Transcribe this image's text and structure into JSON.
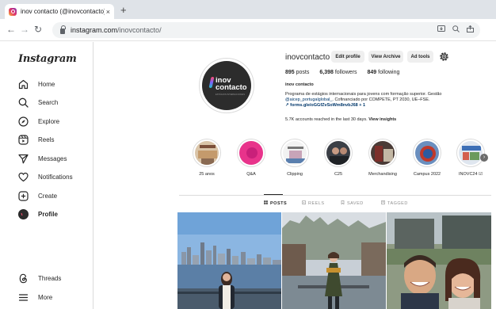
{
  "browser": {
    "tab_title": "inov contacto (@inovcontacto) •",
    "tab_close": "×",
    "new_tab": "+",
    "back": "←",
    "forward": "→",
    "reload": "↻",
    "url_host": "instagram.com",
    "url_path": "/inovcontacto/"
  },
  "sidebar": {
    "logo": "Instagram",
    "items": [
      {
        "label": "Home",
        "icon": "home-icon"
      },
      {
        "label": "Search",
        "icon": "search-icon"
      },
      {
        "label": "Explore",
        "icon": "compass-icon"
      },
      {
        "label": "Reels",
        "icon": "reels-icon"
      },
      {
        "label": "Messages",
        "icon": "messages-icon"
      },
      {
        "label": "Notifications",
        "icon": "heart-icon"
      },
      {
        "label": "Create",
        "icon": "plus-square-icon"
      },
      {
        "label": "Profile",
        "icon": "profile-avatar-icon"
      }
    ],
    "bottom": [
      {
        "label": "Threads",
        "icon": "threads-icon"
      },
      {
        "label": "More",
        "icon": "menu-icon"
      }
    ]
  },
  "profile": {
    "avatar_text_1": "inov",
    "avatar_text_2": "contacto",
    "avatar_sub": "ESTÁGIOS INTERNACIONAIS",
    "username": "inovcontacto",
    "buttons": {
      "edit": "Edit profile",
      "archive": "View Archive",
      "ad_tools": "Ad tools"
    },
    "stats": {
      "posts_count": "895",
      "posts_label": "posts",
      "followers_count": "6,398",
      "followers_label": "followers",
      "following_count": "849",
      "following_label": "following"
    },
    "bio_name": "inov contacto",
    "bio_line1": "Programa de estágios internacionais para jovens com formação superior. Gestão",
    "bio_mention": "@aicep_portugalglobal_",
    "bio_line2_rest": ". Cofinanciado por COMPETE, PT 2030, UE–FSE.",
    "bio_link": "forms.gle/oGGfZvSoWm8nvbJ68 + 1",
    "reached_text": "5.7K accounts reached in the last 30 days.",
    "reached_link": "View insights"
  },
  "highlights": [
    {
      "label": "25 anos"
    },
    {
      "label": "Q&A"
    },
    {
      "label": "Clipping"
    },
    {
      "label": "C25"
    },
    {
      "label": "Merchandising"
    },
    {
      "label": "Campus 2022"
    },
    {
      "label": "INOVC24 ☑"
    }
  ],
  "highlight_next": "›",
  "profile_tabs": [
    {
      "label": "POSTS",
      "active": true
    },
    {
      "label": "REELS",
      "active": false
    },
    {
      "label": "SAVED",
      "active": false
    },
    {
      "label": "TAGGED",
      "active": false
    }
  ],
  "colors": {
    "link": "#00376b",
    "border": "#dbdbdb",
    "button_bg": "#efefef",
    "text": "#262626"
  }
}
